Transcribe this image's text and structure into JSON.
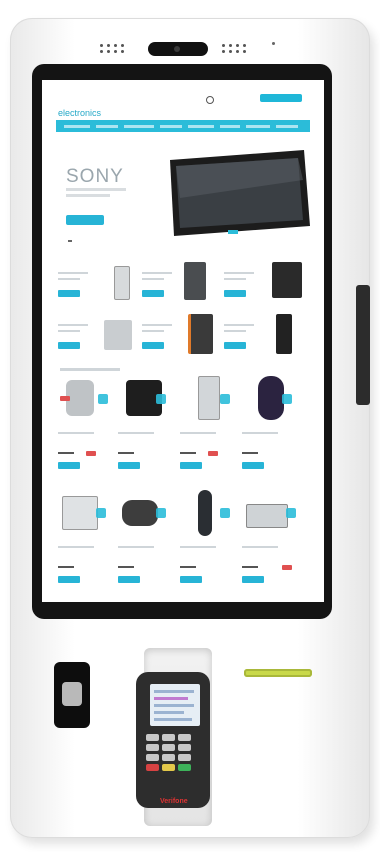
{
  "screen": {
    "brand": "electronics",
    "hero": {
      "brand": "SONY"
    },
    "accent_color": "#27b4d6"
  },
  "hardware": {
    "terminal_brand": "Verifone",
    "card_reader_color": "#c9d94a"
  }
}
